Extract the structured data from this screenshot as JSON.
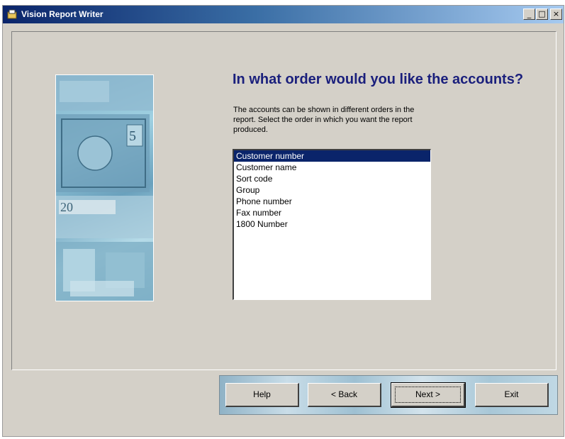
{
  "window": {
    "title": "Vision Report Writer",
    "controls": {
      "minimize": "_",
      "maximize": "□",
      "close": "×"
    }
  },
  "page": {
    "heading": "In what order would you like the accounts?",
    "description": "The accounts can be shown in different orders in the report. Select the order in which you want the report produced."
  },
  "order_list": {
    "selected_index": 0,
    "items": [
      "Customer number",
      "Customer name",
      "Sort code",
      "Group",
      "Phone number",
      "Fax number",
      "1800 Number"
    ]
  },
  "buttons": {
    "help": "Help",
    "back": "< Back",
    "next": "Next >",
    "exit": "Exit"
  },
  "colors": {
    "selection": "#0a246a",
    "heading": "#1a1f7c",
    "titlebar_start": "#0a246a",
    "titlebar_end": "#a6caf0"
  },
  "icons": {
    "app": "folder-app-icon",
    "side_image": "banknotes-image"
  }
}
